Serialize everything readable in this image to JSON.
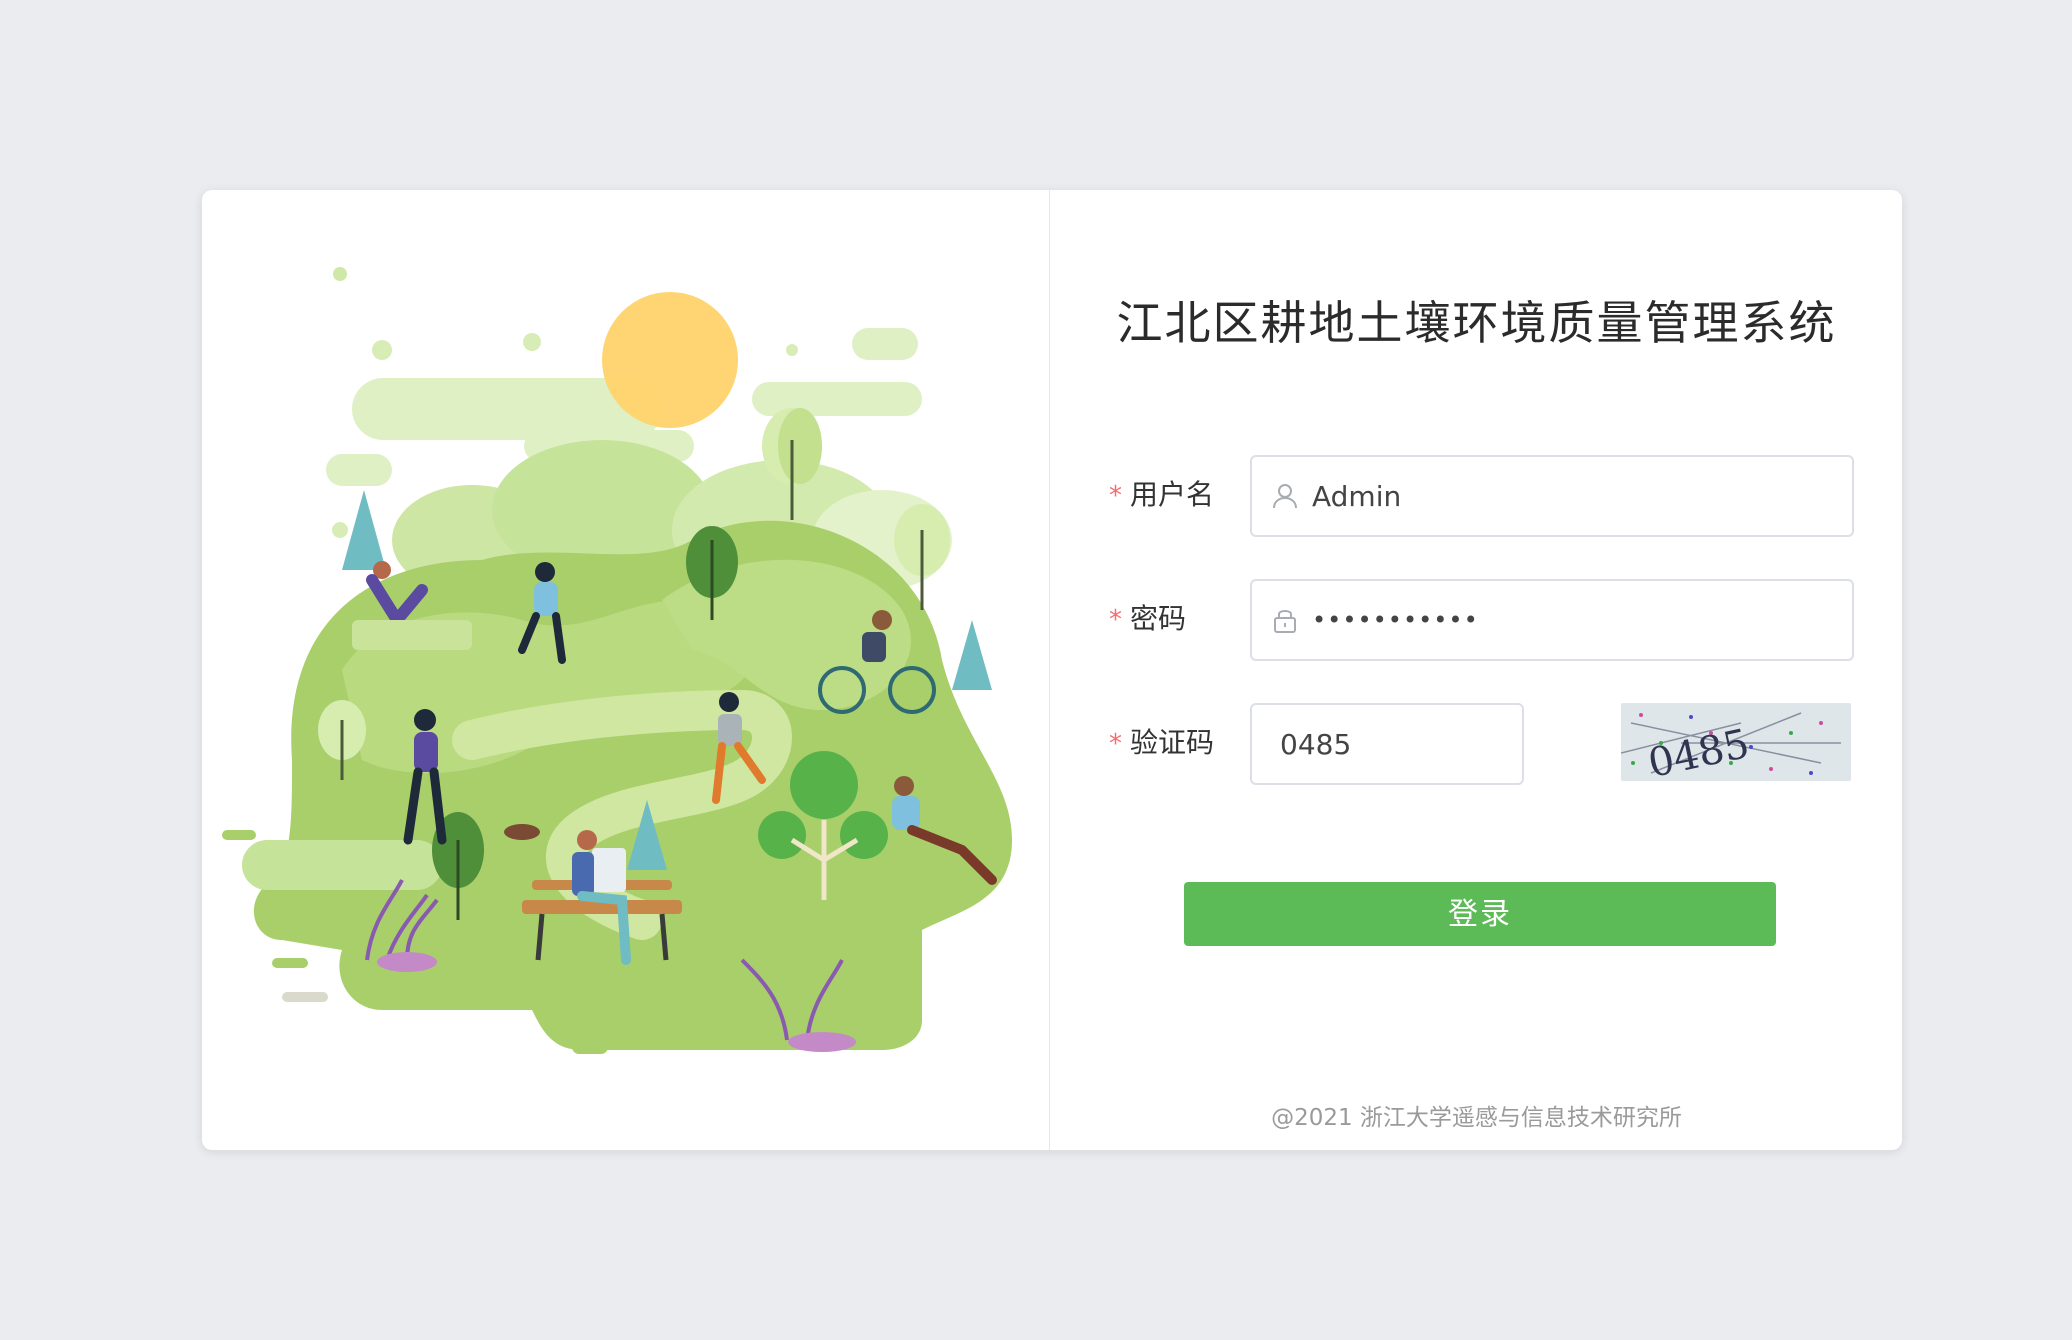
{
  "app": {
    "title": "江北区耕地土壤环境质量管理系统"
  },
  "form": {
    "username": {
      "label": "用户名",
      "required_mark": "*",
      "value": "Admin",
      "icon": "user-icon"
    },
    "password": {
      "label": "密码",
      "required_mark": "*",
      "value": "•••••••••••",
      "icon": "lock-icon"
    },
    "captcha": {
      "label": "验证码",
      "required_mark": "*",
      "value": "0485",
      "image_text": "0485"
    }
  },
  "actions": {
    "login_label": "登录"
  },
  "footer": {
    "copyright": "@2021 浙江大学遥感与信息技术研究所"
  },
  "colors": {
    "background": "#ebecf0",
    "primary_button": "#5cbb57",
    "required": "#f56c6c"
  }
}
